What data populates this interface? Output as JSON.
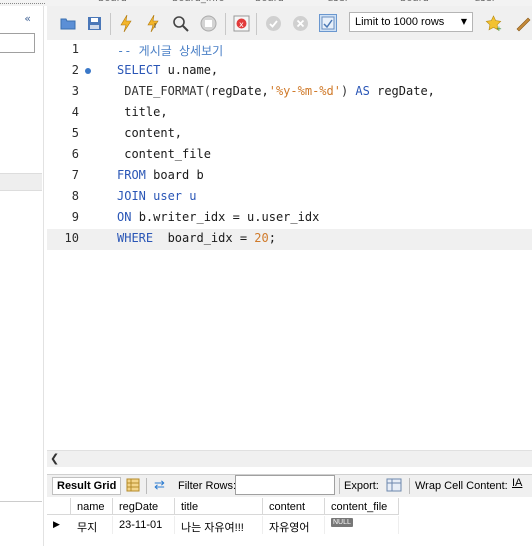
{
  "tabs": [
    "board",
    "board_info",
    "board",
    "user",
    "board",
    "user"
  ],
  "toolbar": {
    "limit_label": "Limit to 1000 rows"
  },
  "editor": {
    "line_numbers": [
      "1",
      "2",
      "3",
      "4",
      "5",
      "6",
      "7",
      "8",
      "9",
      "10"
    ],
    "lines": [
      [
        {
          "t": "-- 게시글 상세보기",
          "c": "cm"
        }
      ],
      [
        {
          "t": "SELECT ",
          "c": "kw"
        },
        {
          "t": "u.name,",
          "c": "plain"
        }
      ],
      [
        {
          "t": " DATE_FORMAT(",
          "c": "fn"
        },
        {
          "t": "regDate,",
          "c": "plain"
        },
        {
          "t": "'%y-%m-%d'",
          "c": "str"
        },
        {
          "t": ") ",
          "c": "fn"
        },
        {
          "t": "AS ",
          "c": "kw"
        },
        {
          "t": "regDate,",
          "c": "plain"
        }
      ],
      [
        {
          "t": " title,",
          "c": "plain"
        }
      ],
      [
        {
          "t": " content,",
          "c": "plain"
        }
      ],
      [
        {
          "t": " content_file",
          "c": "plain"
        }
      ],
      [
        {
          "t": "FROM ",
          "c": "kw"
        },
        {
          "t": "board b",
          "c": "plain"
        }
      ],
      [
        {
          "t": "JOIN ",
          "c": "kw"
        },
        {
          "t": "user u",
          "c": "kw"
        }
      ],
      [
        {
          "t": "ON ",
          "c": "kw"
        },
        {
          "t": "b.writer_idx = u.user_idx",
          "c": "plain"
        }
      ],
      [
        {
          "t": "WHERE  ",
          "c": "kw"
        },
        {
          "t": "board_idx = ",
          "c": "plain"
        },
        {
          "t": "20",
          "c": "num"
        },
        {
          "t": ";",
          "c": "plain"
        }
      ]
    ]
  },
  "result_toolbar": {
    "result_grid": "Result Grid",
    "filter_rows": "Filter Rows:",
    "export": "Export:",
    "wrap": "Wrap Cell Content:"
  },
  "grid": {
    "columns": [
      "name",
      "regDate",
      "title",
      "content",
      "content_file"
    ],
    "rows": [
      [
        "무지",
        "23-11-01",
        "나는 자유여!!!",
        "자유영어",
        "NULL"
      ]
    ]
  }
}
